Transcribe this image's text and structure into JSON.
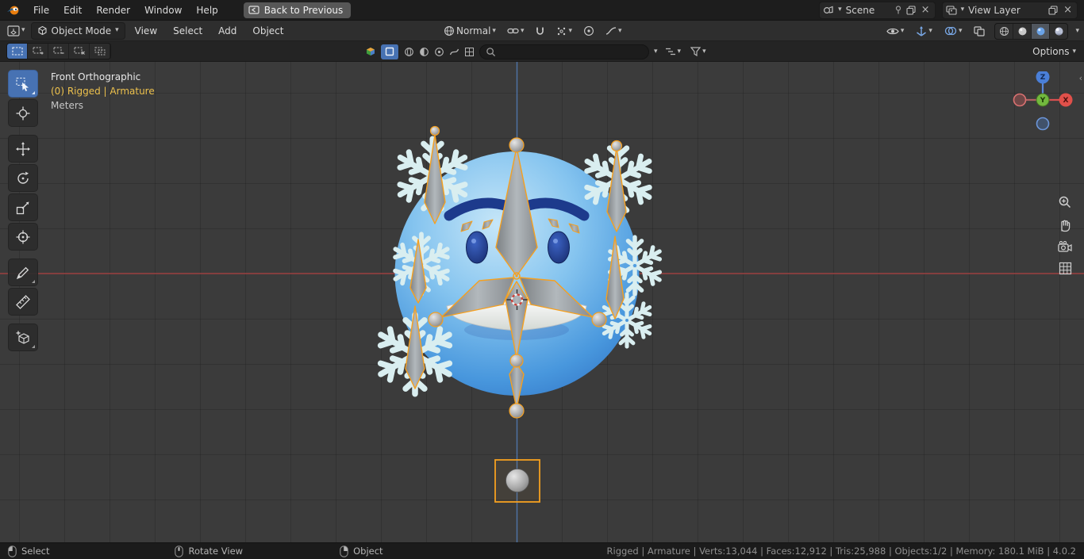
{
  "topbar": {
    "menus": [
      "File",
      "Edit",
      "Render",
      "Window",
      "Help"
    ],
    "back_button": "Back to Previous",
    "scene_field": "Scene",
    "view_layer_field": "View Layer"
  },
  "header": {
    "mode": "Object Mode",
    "menus": [
      "View",
      "Select",
      "Add",
      "Object"
    ],
    "orientation": "Normal"
  },
  "tool_settings": {
    "options": "Options",
    "search_placeholder": "",
    "search_value": ""
  },
  "viewport": {
    "view_label": "Front Orthographic",
    "active_object": "(0) Rigged | Armature",
    "units": "Meters",
    "gizmo": {
      "x": "X",
      "y": "Y",
      "z": "Z"
    }
  },
  "statusbar": {
    "hints": [
      {
        "label": "Select"
      },
      {
        "label": "Rotate View"
      },
      {
        "label": "Object"
      }
    ],
    "stats": "Rigged | Armature | Verts:13,044 | Faces:12,912 | Tris:25,988 | Objects:1/2 | Memory: 180.1 MiB | 4.0.2"
  },
  "colors": {
    "accent": "#4772b3",
    "selection_orange": "#f5a020",
    "axis_x_red": "#9e4343",
    "axis_z_blue": "#4f74a8",
    "head_blue": "#4897dd",
    "snowflake": "#d9eef0",
    "info_yellow": "#edc14d"
  }
}
